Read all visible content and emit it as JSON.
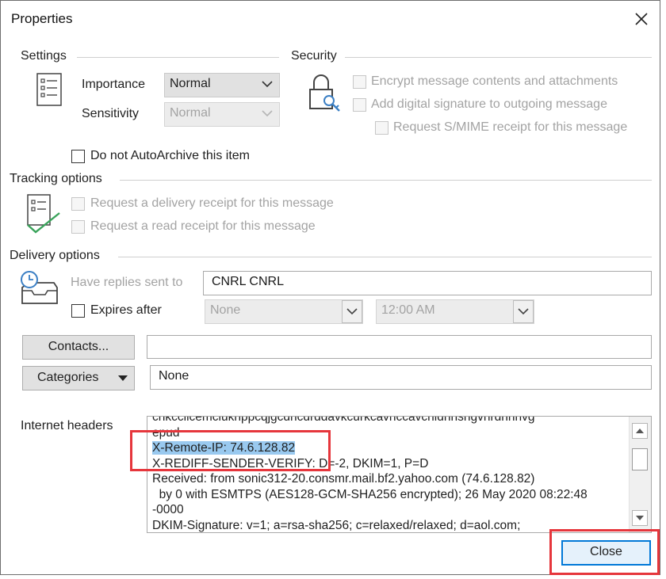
{
  "window": {
    "title": "Properties"
  },
  "settings": {
    "section_label": "Settings",
    "importance_label": "Importance",
    "importance_value": "Normal",
    "sensitivity_label": "Sensitivity",
    "sensitivity_value": "Normal",
    "autoarchive_label": "Do not AutoArchive this item"
  },
  "security": {
    "section_label": "Security",
    "encrypt_label": "Encrypt message contents and attachments",
    "signature_label": "Add digital signature to outgoing message",
    "smime_label": "Request S/MIME receipt for this message"
  },
  "tracking": {
    "section_label": "Tracking options",
    "delivery_receipt_label": "Request a delivery receipt for this message",
    "read_receipt_label": "Request a read receipt for this message"
  },
  "delivery": {
    "section_label": "Delivery options",
    "replies_label": "Have replies sent to",
    "replies_value": "CNRL CNRL",
    "expires_label": "Expires after",
    "expires_date": "None",
    "expires_time": "12:00 AM"
  },
  "contacts": {
    "button_label": "Contacts...",
    "value": ""
  },
  "categories": {
    "button_label": "Categories",
    "value": "None"
  },
  "internet_headers": {
    "label": "Internet headers",
    "lines": [
      "cnkcclicemcluknppcqjgcdncdrddavkcurkcavnccavcnidnnsngvnrdnnnvg",
      "epud",
      "X-Remote-IP: 74.6.128.82",
      "X-REDIFF-SENDER-VERIFY: D=-2, DKIM=1, P=D",
      "Received: from sonic312-20.consmr.mail.bf2.yahoo.com (74.6.128.82)",
      "  by 0 with ESMTPS (AES128-GCM-SHA256 encrypted); 26 May 2020 08:22:48",
      "-0000",
      "DKIM-Signature: v=1; a=rsa-sha256; c=relaxed/relaxed; d=aol.com;"
    ]
  },
  "footer": {
    "close_label": "Close"
  },
  "colors": {
    "accent": "#0078d7",
    "highlight": "#99c9ef",
    "annotation": "#e6363c"
  }
}
